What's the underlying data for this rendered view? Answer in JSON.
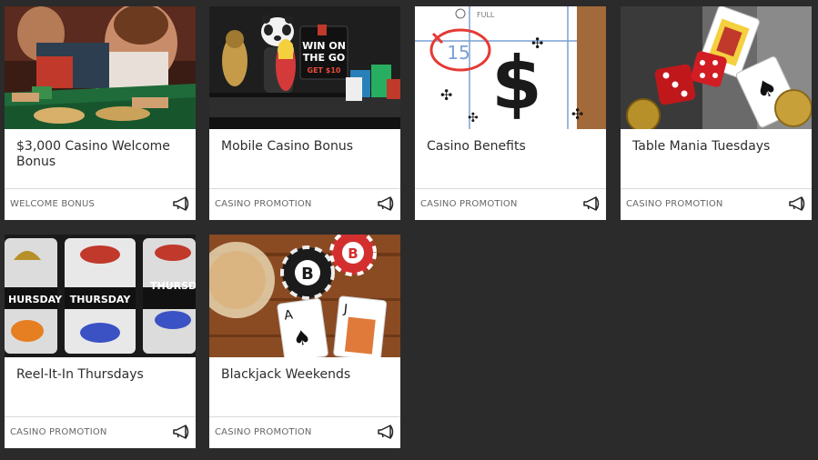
{
  "promotions": [
    {
      "title": "$3,000 Casino Welcome Bonus",
      "category": "WELCOME BONUS",
      "image": "casino-table-celebration-image"
    },
    {
      "title": "Mobile Casino Bonus",
      "category": "CASINO PROMOTION",
      "image": "mobile-panda-win-on-the-go-image",
      "image_text": {
        "line1": "WIN ON",
        "line2": "THE GO",
        "line3": "GET $10"
      }
    },
    {
      "title": "Casino Benefits",
      "category": "CASINO PROMOTION",
      "image": "calendar-dollar-sign-image",
      "image_text": {
        "date": "15",
        "full": "FULL"
      }
    },
    {
      "title": "Table Mania Tuesdays",
      "category": "CASINO PROMOTION",
      "image": "dice-and-cards-image"
    },
    {
      "title": "Reel-It-In Thursdays",
      "category": "CASINO PROMOTION",
      "image": "slot-reels-image",
      "image_text": {
        "reel": "THURSDAY",
        "reel_left": "HURSDAY",
        "reel_right": "THURSDA"
      }
    },
    {
      "title": "Blackjack Weekends",
      "category": "CASINO PROMOTION",
      "image": "blackjack-chips-cards-image"
    }
  ],
  "colors": {
    "page_bg": "#2b2b2b",
    "card_bg": "#ffffff",
    "accent_red": "#d32f2f"
  }
}
